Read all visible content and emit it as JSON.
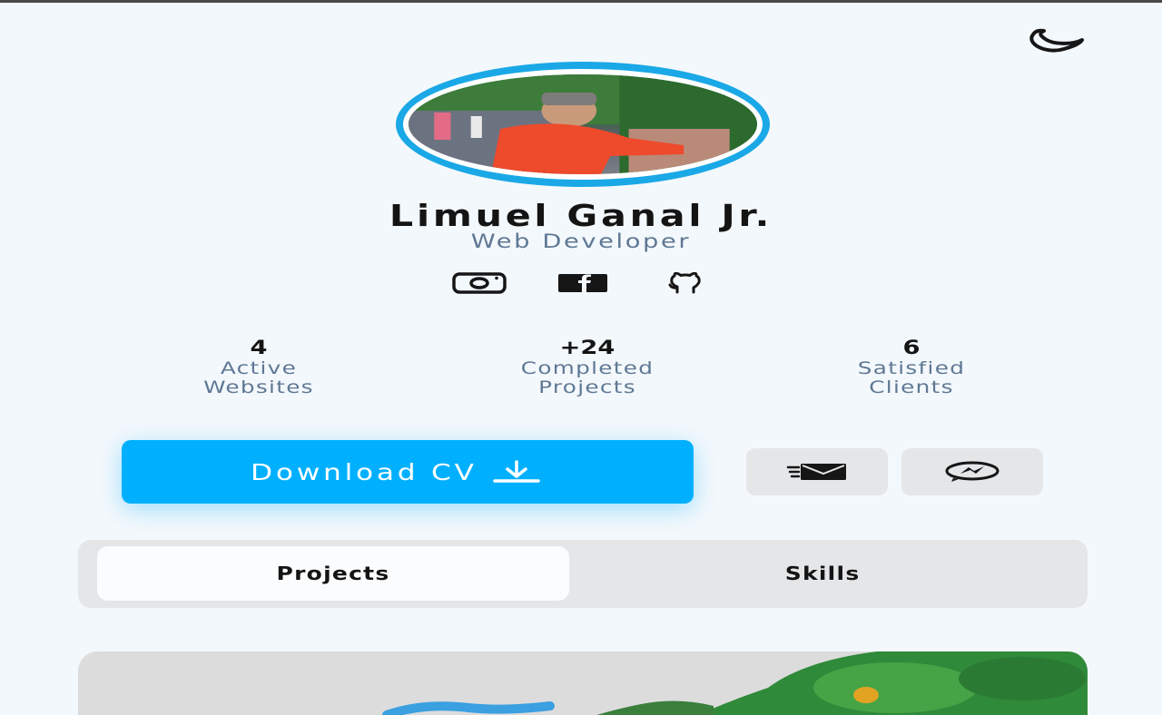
{
  "profile": {
    "name": "Limuel Ganal Jr.",
    "role": "Web Developer"
  },
  "icons": {
    "theme_toggle": "moon-icon",
    "socials": [
      "instagram-icon",
      "facebook-icon",
      "github-icon"
    ],
    "download": "download-icon",
    "email": "email-icon",
    "messenger": "messenger-icon"
  },
  "stats": [
    {
      "value": "4",
      "label_line1": "Active",
      "label_line2": "Websites"
    },
    {
      "value": "+24",
      "label_line1": "Completed",
      "label_line2": "Projects"
    },
    {
      "value": "6",
      "label_line1": "Satisfied",
      "label_line2": "Clients"
    }
  ],
  "actions": {
    "download_label": "Download CV"
  },
  "tabs": [
    {
      "label": "Projects",
      "active": true
    },
    {
      "label": "Skills",
      "active": false
    }
  ],
  "colors": {
    "accent": "#00b0ff",
    "ring": "#1aa8e6",
    "muted_text": "#5f7894",
    "background": "#f3f8fc"
  }
}
